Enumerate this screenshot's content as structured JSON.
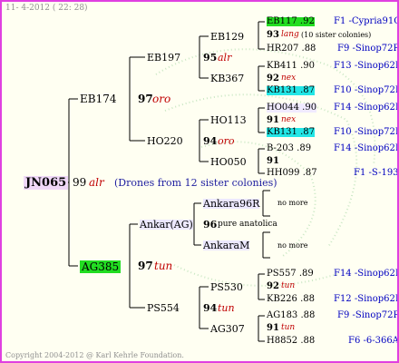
{
  "header": {
    "date": "11- 4-2012 ( 22: 28)"
  },
  "footer": {
    "copyright": "Copyright 2004-2012 @ Karl Kehrle Foundation."
  },
  "root": {
    "id": "JN065",
    "num": "99",
    "race": "alr",
    "note": "(Drones from 12 sister colonies)"
  },
  "gen1": [
    {
      "id": "EB174",
      "num": "97",
      "race": "oro"
    },
    {
      "id": "AG385",
      "num": "97",
      "race": "tun"
    }
  ],
  "gen2": [
    {
      "id": "EB197",
      "num": "95",
      "race": "alr"
    },
    {
      "id": "HO220",
      "num": "94",
      "race": "oro"
    },
    {
      "id": "Ankar(AG)",
      "num": "96",
      "race": "pure anatolica"
    },
    {
      "id": "PS554",
      "num": "94",
      "race": "tun"
    }
  ],
  "gen3": [
    {
      "id": "EB129"
    },
    {
      "id": "KB367"
    },
    {
      "id": "HO113"
    },
    {
      "id": "HO050"
    },
    {
      "id": "Ankara96R"
    },
    {
      "id": "AnkaraM"
    },
    {
      "id": "PS530"
    },
    {
      "id": "AG307"
    }
  ],
  "nomore": "no more",
  "gen4": [
    {
      "id": "EB117 .92",
      "src": "F1 -Cypria91Q"
    },
    {
      "num": "93",
      "race": "lang",
      "note": "(10 sister colonies)"
    },
    {
      "id": "HR207 .88",
      "src": "F9 -Sinop72R"
    },
    {
      "id": "KB411 .90",
      "src": "F13 -Sinop62R"
    },
    {
      "num": "92",
      "race": "nex"
    },
    {
      "id": "KB131 .87",
      "src": "F10 -Sinop72R"
    },
    {
      "id": "HO044 .90",
      "src": "F14 -Sinop62R"
    },
    {
      "num": "91",
      "race": "nex"
    },
    {
      "id": "KB131 .87",
      "src": "F10 -Sinop72R"
    },
    {
      "id": "B-203 .89",
      "src": "F14 -Sinop62R"
    },
    {
      "num": "91"
    },
    {
      "id": "HH099 .87",
      "src": "F1 -S-193"
    },
    {
      "id": "PS557 .89",
      "src": "F14 -Sinop62R"
    },
    {
      "num": "92",
      "race": "tun"
    },
    {
      "id": "KB226 .88",
      "src": "F12 -Sinop62R"
    },
    {
      "id": "AG183 .88",
      "src": "F9 -Sinop72R"
    },
    {
      "num": "91",
      "race": "tun"
    },
    {
      "id": "H8852 .88",
      "src": "F6 -6-366A"
    }
  ]
}
